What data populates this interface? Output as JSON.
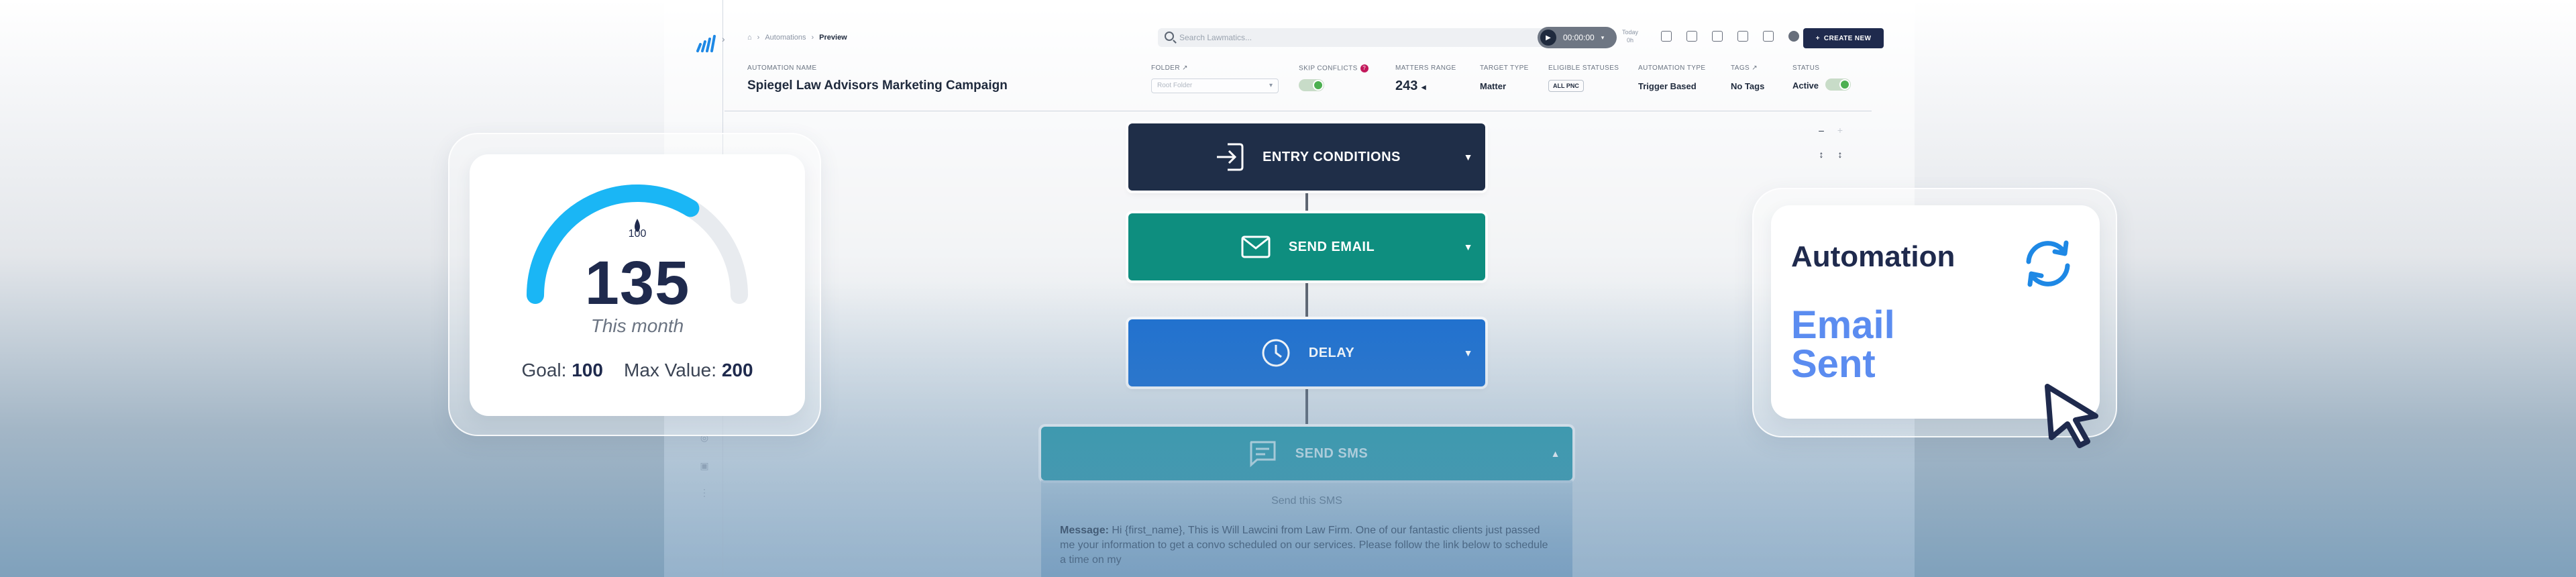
{
  "breadcrumb": {
    "items": [
      "Automations"
    ],
    "current": "Preview"
  },
  "search": {
    "placeholder": "Search Lawmatics..."
  },
  "timer": {
    "value": "00:00:00",
    "today_label": "Today",
    "today_value": "0h"
  },
  "create_button": {
    "label": "CREATE NEW"
  },
  "header": {
    "automation_name": {
      "label": "AUTOMATION NAME",
      "value": "Spiegel Law Advisors Marketing Campaign"
    },
    "folder": {
      "label": "FOLDER",
      "placeholder": "Root Folder"
    },
    "skip_conflicts": {
      "label": "SKIP CONFLICTS",
      "on": true
    },
    "matters_range": {
      "label": "MATTERS RANGE",
      "value": "243"
    },
    "target_type": {
      "label": "TARGET TYPE",
      "value": "Matter"
    },
    "eligible_statuses": {
      "label": "ELIGIBLE STATUSES",
      "value": "ALL PNC"
    },
    "automation_type": {
      "label": "AUTOMATION TYPE",
      "value": "Trigger Based"
    },
    "tags": {
      "label": "TAGS",
      "value": "No Tags"
    },
    "status": {
      "label": "STATUS",
      "value": "Active",
      "on": true
    }
  },
  "flow": {
    "entry": {
      "label": "ENTRY CONDITIONS",
      "icon": "entry-icon",
      "color": "#1f2e48"
    },
    "email": {
      "label": "SEND EMAIL",
      "icon": "envelope-icon",
      "color": "#0e8e7f"
    },
    "delay": {
      "label": "DELAY",
      "icon": "clock-icon",
      "color": "#1c6fd0"
    },
    "sms": {
      "label": "SEND SMS",
      "icon": "chat-icon",
      "color": "#2d9aab",
      "panel_title": "Send this SMS",
      "message_key": "Message:",
      "message": "Hi {first_name}, This is Will Lawcini from Law Firm. One of our fantastic clients just passed me your information to get a convo scheduled on our services. Please follow the link below to schedule a time on my"
    }
  },
  "gauge": {
    "value": "135",
    "value_num": 135,
    "goal_num": 100,
    "max_num": 200,
    "marker_label": "100",
    "period": "This month",
    "goal_label": "Goal:",
    "goal_value": "100",
    "max_label": "Max Value:",
    "max_value": "200",
    "accent": "#1ab6f5"
  },
  "automation_card": {
    "title": "Automation",
    "subtitle_line1": "Email",
    "subtitle_line2": "Sent",
    "accent": "#1e88e5"
  }
}
